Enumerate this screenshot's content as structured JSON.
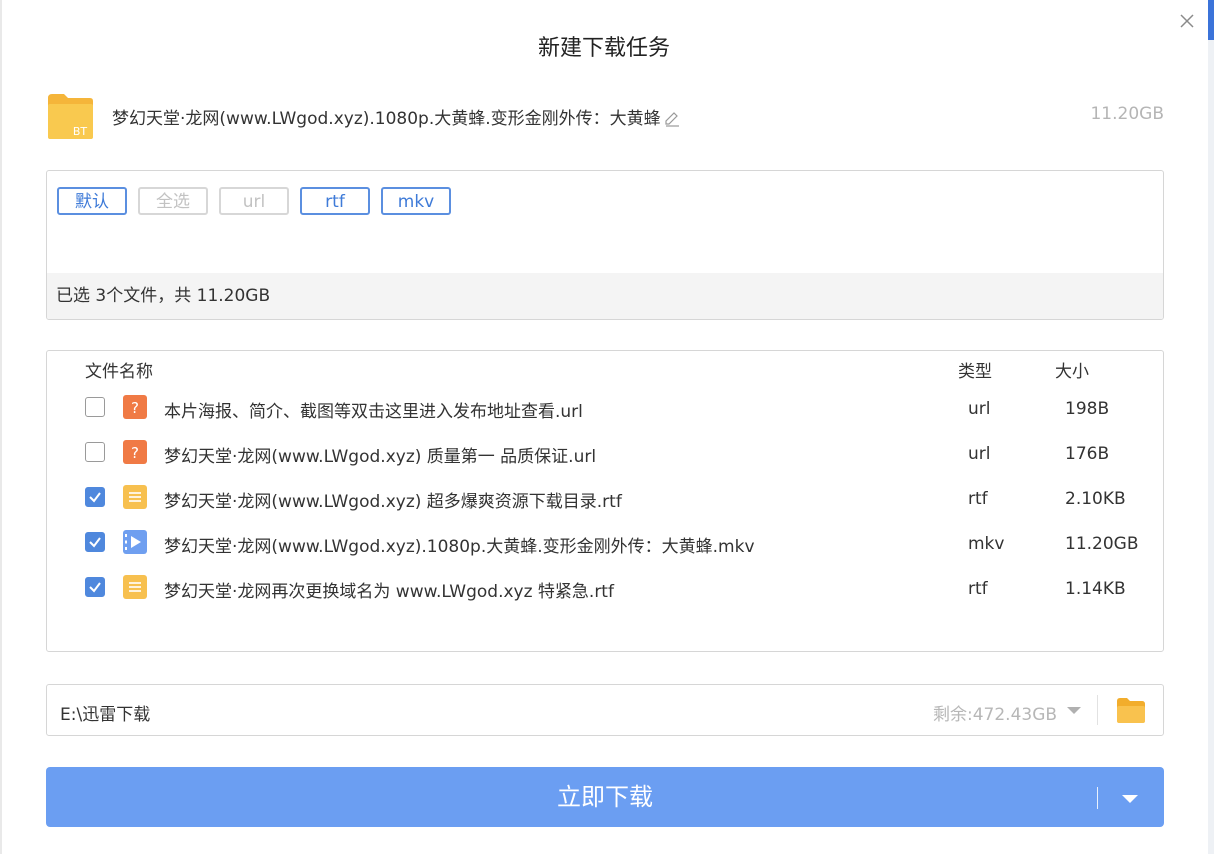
{
  "dialog": {
    "title": "新建下载任务"
  },
  "task": {
    "name": "梦幻天堂·龙网(www.LWgod.xyz).1080p.大黄蜂.变形金刚外传：大黄蜂",
    "total_size": "11.20GB",
    "icon": "bt-folder-icon",
    "icon_badge": "BT"
  },
  "filters": {
    "chips": [
      {
        "label": "默认",
        "enabled": true
      },
      {
        "label": "全选",
        "enabled": false
      },
      {
        "label": "url",
        "enabled": false
      },
      {
        "label": "rtf",
        "enabled": true
      },
      {
        "label": "mkv",
        "enabled": true
      }
    ],
    "summary": "已选 3个文件，共 11.20GB"
  },
  "table": {
    "headers": {
      "name": "文件名称",
      "type": "类型",
      "size": "大小"
    },
    "rows": [
      {
        "checked": false,
        "icon": "url-file-icon",
        "name": "本片海报、简介、截图等双击这里进入发布地址查看.url",
        "type": "url",
        "size": "198B"
      },
      {
        "checked": false,
        "icon": "url-file-icon",
        "name": "梦幻天堂·龙网(www.LWgod.xyz) 质量第一 品质保证.url",
        "type": "url",
        "size": "176B"
      },
      {
        "checked": true,
        "icon": "rtf-file-icon",
        "name": "梦幻天堂·龙网(www.LWgod.xyz) 超多爆爽资源下载目录.rtf",
        "type": "rtf",
        "size": "2.10KB"
      },
      {
        "checked": true,
        "icon": "video-file-icon",
        "name": "梦幻天堂·龙网(www.LWgod.xyz).1080p.大黄蜂.变形金刚外传：大黄蜂.mkv",
        "type": "mkv",
        "size": "11.20GB"
      },
      {
        "checked": true,
        "icon": "rtf-file-icon",
        "name": "梦幻天堂·龙网再次更换域名为 www.LWgod.xyz 特紧急.rtf",
        "type": "rtf",
        "size": "1.14KB"
      }
    ]
  },
  "save_path": {
    "path": "E:\\迅雷下载",
    "free_space": "剩余:472.43GB"
  },
  "download_button": {
    "label": "立即下载"
  },
  "colors": {
    "accent": "#6b9ef2",
    "checkbox": "#4f88dd",
    "chip_border": "#5b8fe0",
    "url_icon": "#f07a45",
    "rtf_icon": "#f7c04f",
    "video_icon": "#6f9ff0",
    "folder": "#f9c24e"
  }
}
